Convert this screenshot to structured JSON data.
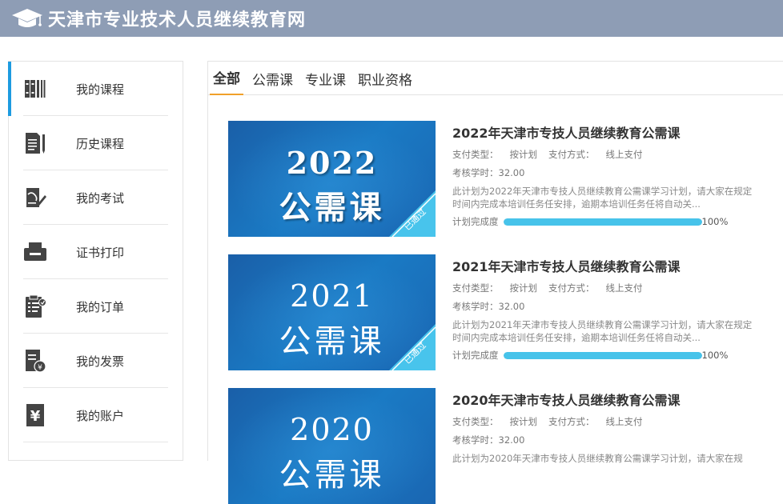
{
  "header": {
    "title": "天津市专业技术人员继续教育网",
    "color": "#8e9db5"
  },
  "sidebar": {
    "accent": "#1d9be0",
    "items": [
      {
        "label": "我的课程",
        "icon": "books-icon"
      },
      {
        "label": "历史课程",
        "icon": "document-pen-icon"
      },
      {
        "label": "我的考试",
        "icon": "exam-icon"
      },
      {
        "label": "证书打印",
        "icon": "printer-icon"
      },
      {
        "label": "我的订单",
        "icon": "order-clipboard-icon"
      },
      {
        "label": "我的发票",
        "icon": "invoice-icon"
      },
      {
        "label": "我的账户",
        "icon": "yuan-account-icon"
      }
    ]
  },
  "tabs": [
    {
      "label": "全部"
    },
    {
      "label": "公需课"
    },
    {
      "label": "专业课"
    },
    {
      "label": "职业资格"
    }
  ],
  "courses": [
    {
      "thumb_year": "2022",
      "thumb_subject": "公需课",
      "badge": "已通过",
      "title": "2022年天津市专技人员继续教育公需课",
      "pay_type_label": "支付类型：",
      "pay_type": "按计划",
      "pay_method_label": "支付方式：",
      "pay_method": "线上支付",
      "hours_label": "考核学时：",
      "hours": "32.00",
      "description": "此计划为2022年天津市专技人员继续教育公需课学习计划，请大家在规定时间内完成本培训任务任安排，逾期本培训任务任将自动关...",
      "progress_label": "计划完成度",
      "progress_text": "100%",
      "progress": 1.0
    },
    {
      "thumb_year": "2021",
      "thumb_subject": "公需课",
      "badge": "已通过",
      "title": "2021年天津市专技人员继续教育公需课",
      "pay_type_label": "支付类型：",
      "pay_type": "按计划",
      "pay_method_label": "支付方式：",
      "pay_method": "线上支付",
      "hours_label": "考核学时：",
      "hours": "32.00",
      "description": "此计划为2021年天津市专技人员继续教育公需课学习计划，请大家在规定时间内完成本培训任务任安排，逾期本培训任务任将自动关...",
      "progress_label": "计划完成度",
      "progress_text": "100%",
      "progress": 1.0
    },
    {
      "thumb_year": "2020",
      "thumb_subject": "公需课",
      "title": "2020年天津市专技人员继续教育公需课",
      "pay_type_label": "支付类型：",
      "pay_type": "按计划",
      "pay_method_label": "支付方式：",
      "pay_method": "线上支付",
      "hours_label": "考核学时：",
      "hours": "32.00",
      "description": "此计划为2020年天津市专技人员继续教育公需课学习计划，请大家在规"
    }
  ]
}
